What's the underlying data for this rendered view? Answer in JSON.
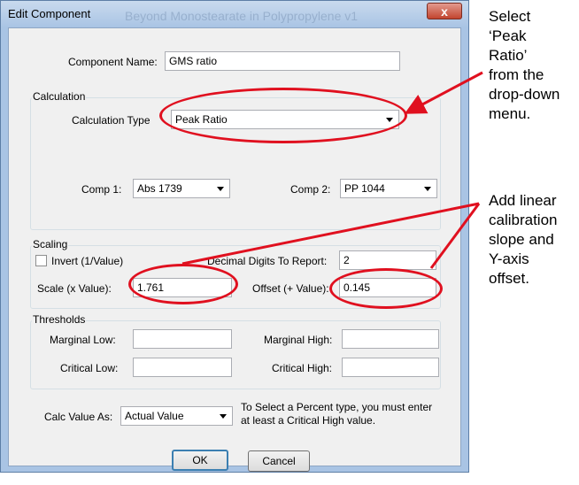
{
  "dialog": {
    "title": "Edit Component",
    "ghost_title": "Beyond Monostearate in Polypropylene v1",
    "close_glyph": "x",
    "component_name_label": "Component Name:",
    "component_name_value": "GMS ratio",
    "calculation": {
      "group_label": "Calculation",
      "type_label": "Calculation Type",
      "type_value": "Peak Ratio",
      "comp1_label": "Comp 1:",
      "comp1_value": "Abs 1739",
      "comp2_label": "Comp 2:",
      "comp2_value": "PP 1044"
    },
    "scaling": {
      "group_label": "Scaling",
      "invert_label": "Invert (1/Value)",
      "invert_checked": false,
      "decimal_label": "Decimal Digits To Report:",
      "decimal_value": "2",
      "scale_label": "Scale (x Value):",
      "scale_value": "1.761",
      "offset_label": "Offset (+ Value):",
      "offset_value": "0.145"
    },
    "thresholds": {
      "group_label": "Thresholds",
      "marginal_low_label": "Marginal Low:",
      "marginal_low_value": "",
      "marginal_high_label": "Marginal High:",
      "marginal_high_value": "",
      "critical_low_label": "Critical Low:",
      "critical_low_value": "",
      "critical_high_label": "Critical High:",
      "critical_high_value": ""
    },
    "calc_value": {
      "label": "Calc Value As:",
      "value": "Actual Value",
      "note_line1": "To Select a Percent type, you must enter",
      "note_line2": "at least a Critical High value."
    },
    "ok_label": "OK",
    "cancel_label": "Cancel"
  },
  "annotations": {
    "color": "#e0101f",
    "note1": [
      "Select",
      "‘Peak",
      "Ratio’",
      "from the",
      "drop-down",
      "menu."
    ],
    "note2": [
      "Add linear",
      "calibration",
      "slope and",
      "Y-axis",
      "offset."
    ]
  }
}
